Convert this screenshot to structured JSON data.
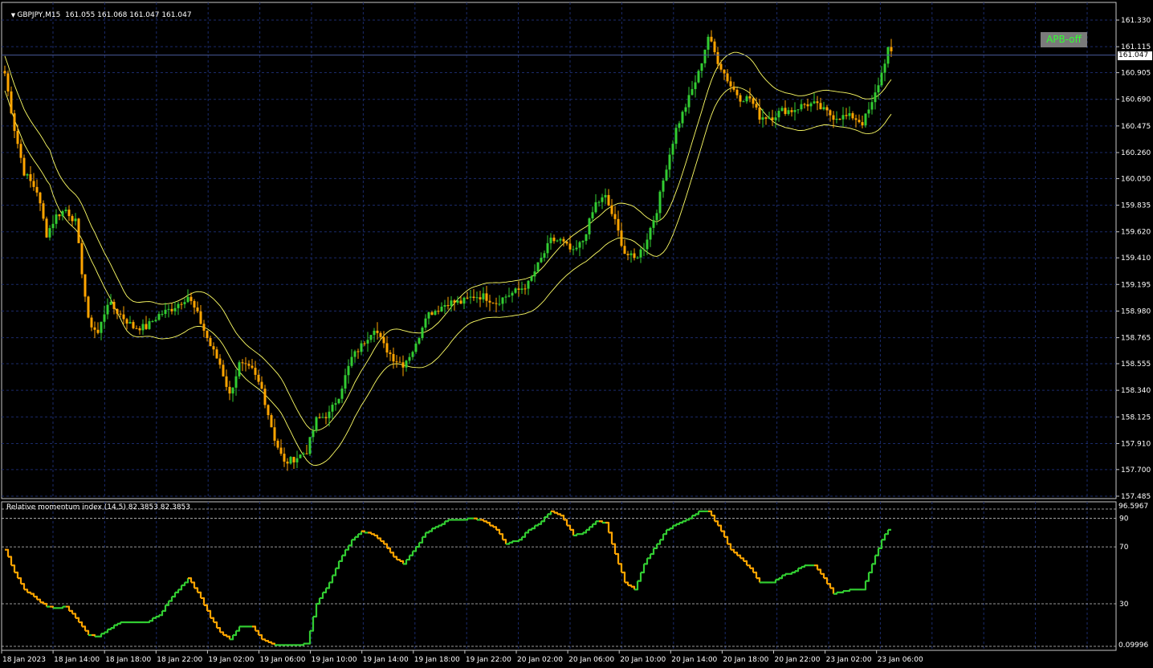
{
  "header": {
    "symbol_line": "GBPJPY,M15  161.055 161.068 161.047 161.047",
    "indicator_line": "Relative momentum index (14,5) 82.3853 82.3853",
    "badge": "APB-off"
  },
  "current_price_label": "161.047",
  "indicator_top_label": "96.5967",
  "indicator_bottom_label": "0.09996",
  "colors": {
    "background": "#000000",
    "grid": "#1b2b6b",
    "bull": "#32cd32",
    "bear": "#ffa500",
    "envelope": "#ffff66",
    "rmi_up": "#32cd32",
    "rmi_down": "#ffa500"
  },
  "chart_data": [
    {
      "type": "candlestick",
      "title": "GBPJPY,M15",
      "ohlc_readout": [
        161.055,
        161.068,
        161.047,
        161.047
      ],
      "y_ticks": [
        "161.330",
        "161.115",
        "160.905",
        "160.690",
        "160.475",
        "160.260",
        "160.050",
        "159.835",
        "159.620",
        "159.410",
        "159.195",
        "158.980",
        "158.765",
        "158.555",
        "158.340",
        "158.125",
        "157.910",
        "157.700",
        "157.485"
      ],
      "ylim": [
        157.485,
        161.4
      ],
      "x_ticks": [
        "18 Jan 2023",
        "18 Jan 14:00",
        "18 Jan 18:00",
        "18 Jan 22:00",
        "19 Jan 02:00",
        "19 Jan 06:00",
        "19 Jan 10:00",
        "19 Jan 14:00",
        "19 Jan 18:00",
        "19 Jan 22:00",
        "20 Jan 02:00",
        "20 Jan 06:00",
        "20 Jan 10:00",
        "20 Jan 14:00",
        "20 Jan 18:00",
        "20 Jan 22:00",
        "23 Jan 02:00",
        "23 Jan 06:00"
      ],
      "close_path": [
        {
          "i": 0,
          "v": 160.9
        },
        {
          "i": 3,
          "v": 160.45
        },
        {
          "i": 6,
          "v": 160.1
        },
        {
          "i": 10,
          "v": 159.95
        },
        {
          "i": 13,
          "v": 159.6
        },
        {
          "i": 16,
          "v": 159.75
        },
        {
          "i": 19,
          "v": 159.8
        },
        {
          "i": 22,
          "v": 159.7
        },
        {
          "i": 26,
          "v": 158.9
        },
        {
          "i": 29,
          "v": 158.8
        },
        {
          "i": 32,
          "v": 159.05
        },
        {
          "i": 36,
          "v": 158.95
        },
        {
          "i": 40,
          "v": 158.85
        },
        {
          "i": 44,
          "v": 158.85
        },
        {
          "i": 48,
          "v": 158.95
        },
        {
          "i": 52,
          "v": 159.0
        },
        {
          "i": 57,
          "v": 159.1
        },
        {
          "i": 60,
          "v": 158.95
        },
        {
          "i": 64,
          "v": 158.7
        },
        {
          "i": 67,
          "v": 158.55
        },
        {
          "i": 70,
          "v": 158.3
        },
        {
          "i": 73,
          "v": 158.55
        },
        {
          "i": 77,
          "v": 158.5
        },
        {
          "i": 80,
          "v": 158.35
        },
        {
          "i": 84,
          "v": 157.95
        },
        {
          "i": 87,
          "v": 157.75
        },
        {
          "i": 91,
          "v": 157.8
        },
        {
          "i": 94,
          "v": 157.85
        },
        {
          "i": 97,
          "v": 158.1
        },
        {
          "i": 101,
          "v": 158.15
        },
        {
          "i": 104,
          "v": 158.3
        },
        {
          "i": 108,
          "v": 158.6
        },
        {
          "i": 111,
          "v": 158.7
        },
        {
          "i": 115,
          "v": 158.85
        },
        {
          "i": 118,
          "v": 158.7
        },
        {
          "i": 121,
          "v": 158.6
        },
        {
          "i": 124,
          "v": 158.55
        },
        {
          "i": 128,
          "v": 158.7
        },
        {
          "i": 131,
          "v": 158.95
        },
        {
          "i": 135,
          "v": 159.0
        },
        {
          "i": 138,
          "v": 159.05
        },
        {
          "i": 142,
          "v": 159.05
        },
        {
          "i": 146,
          "v": 159.1
        },
        {
          "i": 149,
          "v": 159.1
        },
        {
          "i": 153,
          "v": 159.05
        },
        {
          "i": 156,
          "v": 159.1
        },
        {
          "i": 160,
          "v": 159.15
        },
        {
          "i": 163,
          "v": 159.2
        },
        {
          "i": 166,
          "v": 159.35
        },
        {
          "i": 170,
          "v": 159.55
        },
        {
          "i": 173,
          "v": 159.55
        },
        {
          "i": 177,
          "v": 159.45
        },
        {
          "i": 180,
          "v": 159.55
        },
        {
          "i": 184,
          "v": 159.85
        },
        {
          "i": 187,
          "v": 159.9
        },
        {
          "i": 190,
          "v": 159.7
        },
        {
          "i": 193,
          "v": 159.45
        },
        {
          "i": 196,
          "v": 159.4
        },
        {
          "i": 199,
          "v": 159.5
        },
        {
          "i": 203,
          "v": 159.8
        },
        {
          "i": 206,
          "v": 160.15
        },
        {
          "i": 209,
          "v": 160.45
        },
        {
          "i": 213,
          "v": 160.7
        },
        {
          "i": 216,
          "v": 160.9
        },
        {
          "i": 219,
          "v": 161.2
        },
        {
          "i": 222,
          "v": 161.0
        },
        {
          "i": 226,
          "v": 160.8
        },
        {
          "i": 229,
          "v": 160.7
        },
        {
          "i": 232,
          "v": 160.7
        },
        {
          "i": 235,
          "v": 160.55
        },
        {
          "i": 239,
          "v": 160.55
        },
        {
          "i": 242,
          "v": 160.6
        },
        {
          "i": 245,
          "v": 160.6
        },
        {
          "i": 249,
          "v": 160.65
        },
        {
          "i": 252,
          "v": 160.65
        },
        {
          "i": 255,
          "v": 160.6
        },
        {
          "i": 258,
          "v": 160.55
        },
        {
          "i": 261,
          "v": 160.55
        },
        {
          "i": 264,
          "v": 160.55
        },
        {
          "i": 267,
          "v": 160.5
        },
        {
          "i": 270,
          "v": 160.65
        },
        {
          "i": 273,
          "v": 160.9
        },
        {
          "i": 275,
          "v": 161.1
        },
        {
          "i": 276,
          "v": 161.05
        }
      ]
    },
    {
      "type": "line",
      "title": "Relative momentum index (14,5)",
      "values_readout": [
        82.3853,
        82.3853
      ],
      "ylim": [
        0.09996,
        96.5967
      ],
      "y_ticks": [
        "96.5967",
        "90",
        "70",
        "30",
        "0.09996"
      ],
      "levels": [
        90,
        70,
        30
      ],
      "points": [
        {
          "i": 0,
          "v": 68
        },
        {
          "i": 3,
          "v": 52
        },
        {
          "i": 6,
          "v": 40
        },
        {
          "i": 10,
          "v": 33
        },
        {
          "i": 13,
          "v": 28
        },
        {
          "i": 16,
          "v": 27
        },
        {
          "i": 19,
          "v": 28
        },
        {
          "i": 22,
          "v": 20
        },
        {
          "i": 26,
          "v": 8
        },
        {
          "i": 29,
          "v": 7
        },
        {
          "i": 32,
          "v": 12
        },
        {
          "i": 36,
          "v": 17
        },
        {
          "i": 40,
          "v": 17
        },
        {
          "i": 44,
          "v": 17
        },
        {
          "i": 48,
          "v": 22
        },
        {
          "i": 52,
          "v": 35
        },
        {
          "i": 57,
          "v": 48
        },
        {
          "i": 60,
          "v": 38
        },
        {
          "i": 64,
          "v": 20
        },
        {
          "i": 67,
          "v": 10
        },
        {
          "i": 70,
          "v": 5
        },
        {
          "i": 73,
          "v": 14
        },
        {
          "i": 77,
          "v": 14
        },
        {
          "i": 80,
          "v": 5
        },
        {
          "i": 84,
          "v": 1
        },
        {
          "i": 87,
          "v": 1
        },
        {
          "i": 91,
          "v": 1
        },
        {
          "i": 94,
          "v": 2
        },
        {
          "i": 97,
          "v": 30
        },
        {
          "i": 101,
          "v": 45
        },
        {
          "i": 104,
          "v": 60
        },
        {
          "i": 108,
          "v": 75
        },
        {
          "i": 111,
          "v": 81
        },
        {
          "i": 115,
          "v": 78
        },
        {
          "i": 118,
          "v": 72
        },
        {
          "i": 121,
          "v": 63
        },
        {
          "i": 124,
          "v": 58
        },
        {
          "i": 128,
          "v": 70
        },
        {
          "i": 131,
          "v": 80
        },
        {
          "i": 135,
          "v": 85
        },
        {
          "i": 138,
          "v": 89
        },
        {
          "i": 142,
          "v": 89
        },
        {
          "i": 146,
          "v": 90
        },
        {
          "i": 149,
          "v": 88
        },
        {
          "i": 153,
          "v": 82
        },
        {
          "i": 156,
          "v": 72
        },
        {
          "i": 160,
          "v": 75
        },
        {
          "i": 163,
          "v": 82
        },
        {
          "i": 166,
          "v": 86
        },
        {
          "i": 170,
          "v": 95
        },
        {
          "i": 173,
          "v": 92
        },
        {
          "i": 177,
          "v": 78
        },
        {
          "i": 180,
          "v": 80
        },
        {
          "i": 184,
          "v": 88
        },
        {
          "i": 187,
          "v": 87
        },
        {
          "i": 190,
          "v": 65
        },
        {
          "i": 193,
          "v": 45
        },
        {
          "i": 196,
          "v": 40
        },
        {
          "i": 199,
          "v": 58
        },
        {
          "i": 203,
          "v": 72
        },
        {
          "i": 206,
          "v": 82
        },
        {
          "i": 209,
          "v": 86
        },
        {
          "i": 213,
          "v": 90
        },
        {
          "i": 216,
          "v": 95
        },
        {
          "i": 219,
          "v": 95
        },
        {
          "i": 222,
          "v": 85
        },
        {
          "i": 226,
          "v": 68
        },
        {
          "i": 229,
          "v": 62
        },
        {
          "i": 232,
          "v": 55
        },
        {
          "i": 235,
          "v": 45
        },
        {
          "i": 239,
          "v": 45
        },
        {
          "i": 242,
          "v": 50
        },
        {
          "i": 245,
          "v": 52
        },
        {
          "i": 249,
          "v": 57
        },
        {
          "i": 252,
          "v": 57
        },
        {
          "i": 255,
          "v": 48
        },
        {
          "i": 258,
          "v": 37
        },
        {
          "i": 261,
          "v": 39
        },
        {
          "i": 264,
          "v": 40
        },
        {
          "i": 267,
          "v": 40
        },
        {
          "i": 270,
          "v": 58
        },
        {
          "i": 273,
          "v": 75
        },
        {
          "i": 275,
          "v": 82
        },
        {
          "i": 276,
          "v": 82.3853
        }
      ]
    }
  ]
}
